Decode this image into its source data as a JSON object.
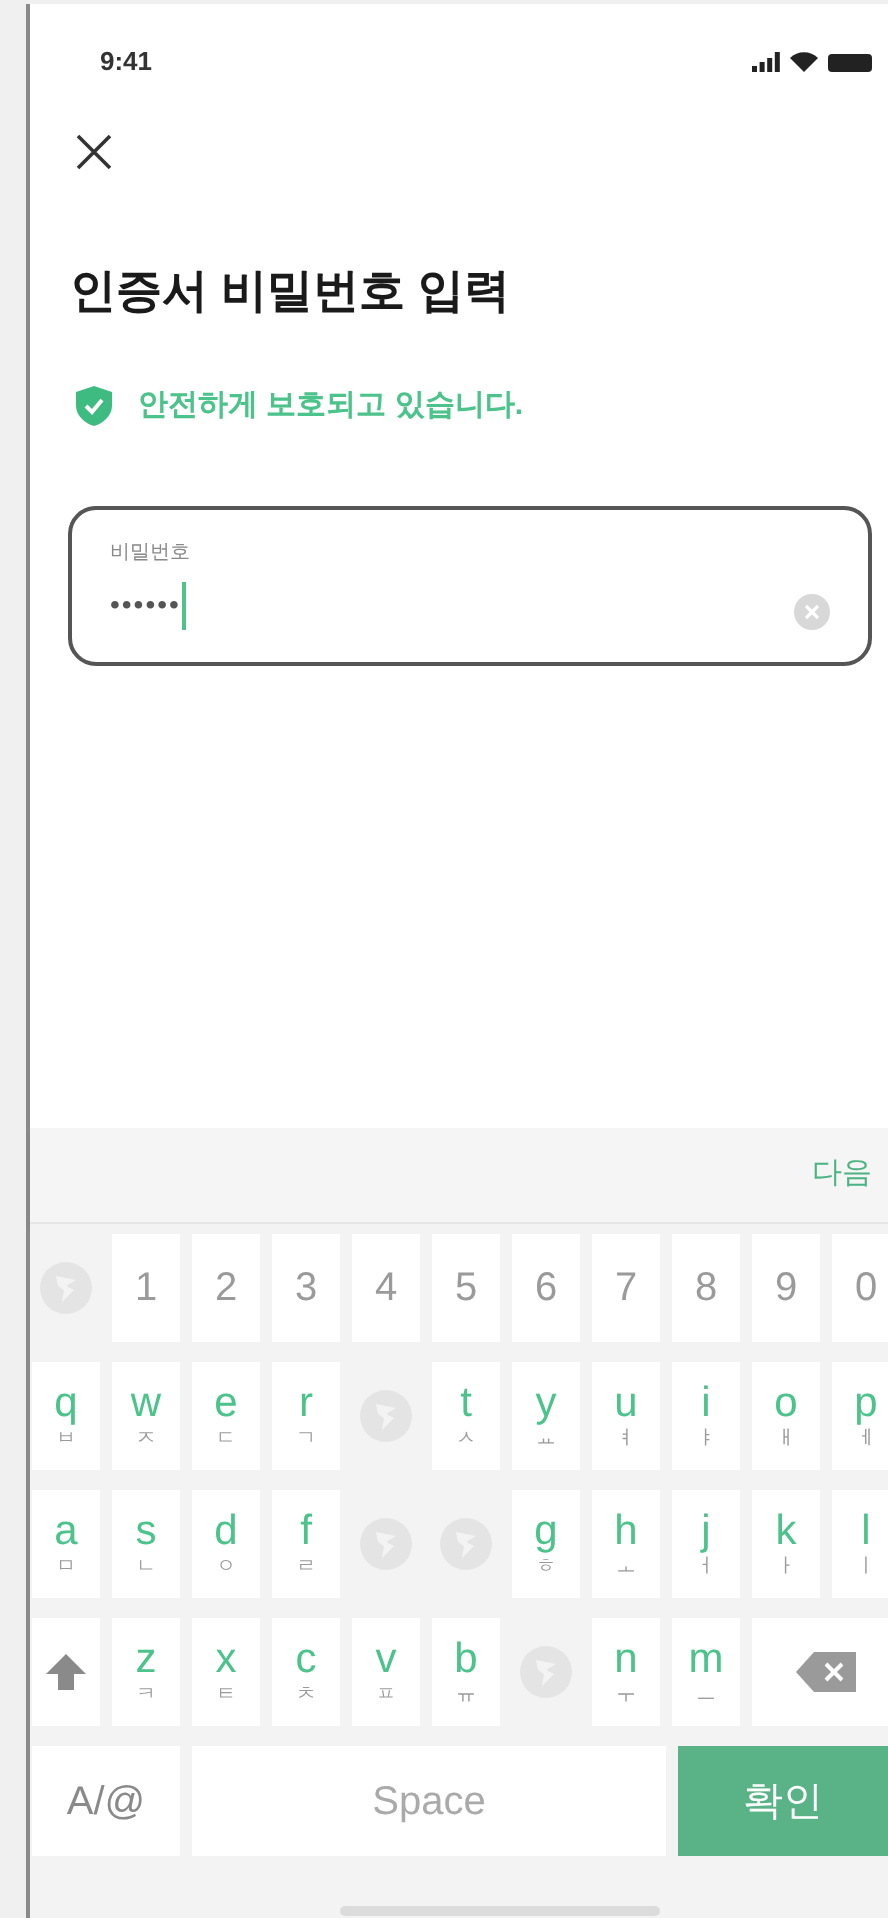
{
  "status_bar": {
    "time": "9:41"
  },
  "title": "인증서 비밀번호 입력",
  "security_notice": "안전하게 보호되고 있습니다.",
  "password_field": {
    "label": "비밀번호",
    "value": "••••••",
    "focused": true
  },
  "keyboard_toolbar": {
    "next": "다음"
  },
  "keyboard": {
    "rows": [
      [
        {
          "kind": "blank"
        },
        {
          "kind": "digit",
          "label": "1"
        },
        {
          "kind": "digit",
          "label": "2"
        },
        {
          "kind": "digit",
          "label": "3"
        },
        {
          "kind": "digit",
          "label": "4"
        },
        {
          "kind": "digit",
          "label": "5"
        },
        {
          "kind": "digit",
          "label": "6"
        },
        {
          "kind": "digit",
          "label": "7"
        },
        {
          "kind": "digit",
          "label": "8"
        },
        {
          "kind": "digit",
          "label": "9"
        },
        {
          "kind": "digit",
          "label": "0"
        }
      ],
      [
        {
          "kind": "letter",
          "label": "q",
          "sub": "ㅂ"
        },
        {
          "kind": "letter",
          "label": "w",
          "sub": "ㅈ"
        },
        {
          "kind": "letter",
          "label": "e",
          "sub": "ㄷ"
        },
        {
          "kind": "letter",
          "label": "r",
          "sub": "ㄱ"
        },
        {
          "kind": "blank"
        },
        {
          "kind": "letter",
          "label": "t",
          "sub": "ㅅ"
        },
        {
          "kind": "letter",
          "label": "y",
          "sub": "ㅛ"
        },
        {
          "kind": "letter",
          "label": "u",
          "sub": "ㅕ"
        },
        {
          "kind": "letter",
          "label": "i",
          "sub": "ㅑ"
        },
        {
          "kind": "letter",
          "label": "o",
          "sub": "ㅐ"
        },
        {
          "kind": "letter",
          "label": "p",
          "sub": "ㅔ"
        }
      ],
      [
        {
          "kind": "letter",
          "label": "a",
          "sub": "ㅁ"
        },
        {
          "kind": "letter",
          "label": "s",
          "sub": "ㄴ"
        },
        {
          "kind": "letter",
          "label": "d",
          "sub": "ㅇ"
        },
        {
          "kind": "letter",
          "label": "f",
          "sub": "ㄹ"
        },
        {
          "kind": "blank"
        },
        {
          "kind": "blank"
        },
        {
          "kind": "letter",
          "label": "g",
          "sub": "ㅎ"
        },
        {
          "kind": "letter",
          "label": "h",
          "sub": "ㅗ"
        },
        {
          "kind": "letter",
          "label": "j",
          "sub": "ㅓ"
        },
        {
          "kind": "letter",
          "label": "k",
          "sub": "ㅏ"
        },
        {
          "kind": "letter",
          "label": "l",
          "sub": "ㅣ"
        }
      ],
      [
        {
          "kind": "shift"
        },
        {
          "kind": "letter",
          "label": "z",
          "sub": "ㅋ"
        },
        {
          "kind": "letter",
          "label": "x",
          "sub": "ㅌ"
        },
        {
          "kind": "letter",
          "label": "c",
          "sub": "ㅊ"
        },
        {
          "kind": "letter",
          "label": "v",
          "sub": "ㅍ"
        },
        {
          "kind": "letter",
          "label": "b",
          "sub": "ㅠ"
        },
        {
          "kind": "blank"
        },
        {
          "kind": "letter",
          "label": "n",
          "sub": "ㅜ"
        },
        {
          "kind": "letter",
          "label": "m",
          "sub": "ㅡ"
        },
        {
          "kind": "backspace"
        }
      ]
    ],
    "bottom_row": {
      "mode": "A/@",
      "space": "Space",
      "confirm": "확인"
    }
  }
}
